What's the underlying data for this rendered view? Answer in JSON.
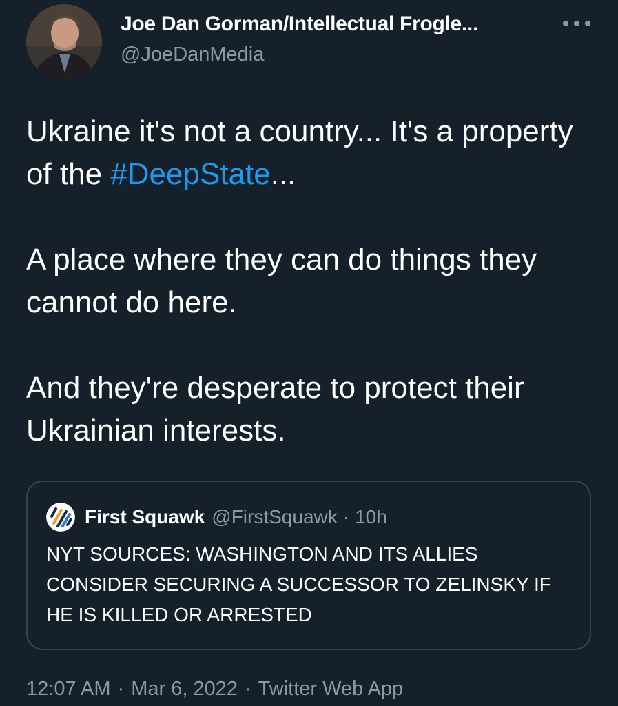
{
  "author": {
    "display_name": "Joe Dan Gorman/Intellectual Frogle...",
    "handle": "@JoeDanMedia",
    "avatar_icon": "profile-photo"
  },
  "more_menu": {
    "icon": "more-horizontal-icon"
  },
  "tweet": {
    "line1_pre": "Ukraine it's not a country... It's a property of the ",
    "hashtag": "#DeepState",
    "line1_post": "...",
    "paragraph2": "A place where they can do things they cannot do here.",
    "paragraph3": "And they're desperate to protect their Ukrainian interests."
  },
  "quoted_tweet": {
    "display_name": "First Squawk",
    "handle": "@FirstSquawk",
    "separator": "·",
    "time": "10h",
    "text": "NYT SOURCES: WASHINGTON AND ITS ALLIES CONSIDER SECURING A SUCCESSOR TO ZELINSKY IF HE IS KILLED OR ARRESTED",
    "avatar_icon": "first-squawk-logo"
  },
  "meta": {
    "time": "12:07 AM",
    "date": "Mar 6, 2022",
    "source": "Twitter Web App",
    "separator": "·"
  },
  "colors": {
    "background": "#15202b",
    "text": "#ffffff",
    "secondary": "#8b98a5",
    "link": "#1d9bf0",
    "border": "#38444d"
  }
}
